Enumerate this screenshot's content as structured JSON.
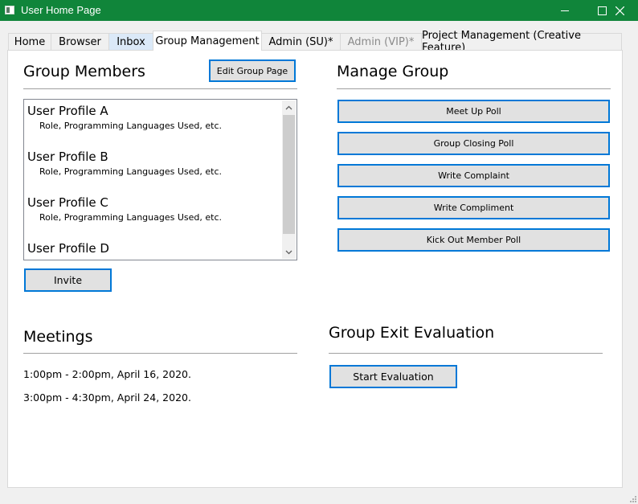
{
  "window": {
    "title": "User Home Page"
  },
  "tabs": [
    {
      "label": "Home"
    },
    {
      "label": "Browser"
    },
    {
      "label": "Inbox"
    },
    {
      "label": "Group Management"
    },
    {
      "label": "Admin (SU)*"
    },
    {
      "label": "Admin (VIP)*"
    },
    {
      "label": "Project Management (Creative Feature)"
    }
  ],
  "group_members": {
    "heading": "Group Members",
    "edit_button": "Edit Group Page",
    "invite_button": "Invite",
    "profiles": [
      {
        "name": "User Profile A",
        "detail": "Role, Programming Languages Used, etc."
      },
      {
        "name": "User Profile B",
        "detail": "Role, Programming Languages Used, etc."
      },
      {
        "name": "User Profile C",
        "detail": "Role, Programming Languages Used, etc."
      },
      {
        "name": "User Profile D",
        "detail": ""
      }
    ]
  },
  "manage_group": {
    "heading": "Manage Group",
    "buttons": [
      "Meet Up Poll",
      "Group Closing Poll",
      "Write Complaint",
      "Write Compliment",
      "Kick Out Member Poll"
    ]
  },
  "meetings": {
    "heading": "Meetings",
    "items": [
      "1:00pm - 2:00pm, April 16, 2020.",
      "3:00pm - 4:30pm, April 24, 2020."
    ]
  },
  "exit_evaluation": {
    "heading": "Group Exit Evaluation",
    "button": "Start Evaluation"
  },
  "colors": {
    "titlebar": "#10853a",
    "focus_border": "#0078d7",
    "button_bg": "#e1e1e1"
  }
}
